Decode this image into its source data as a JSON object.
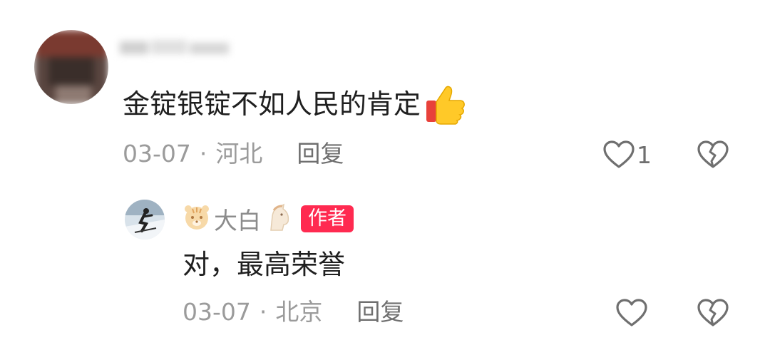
{
  "comment": {
    "text": "金锭银锭不如人民的肯定",
    "emoji": "thumbs-up-icon",
    "date": "03-07",
    "separator": "·",
    "location": "河北",
    "reply_label": "回复",
    "like_count": "1"
  },
  "reply": {
    "username": "大白",
    "author_badge": "作者",
    "text": "对，最高荣誉",
    "date": "03-07",
    "separator": "·",
    "location": "北京",
    "reply_label": "回复"
  },
  "colors": {
    "badge": "#ff2a50",
    "meta_text": "#9b9b9b",
    "icon": "#6f6f6f"
  }
}
